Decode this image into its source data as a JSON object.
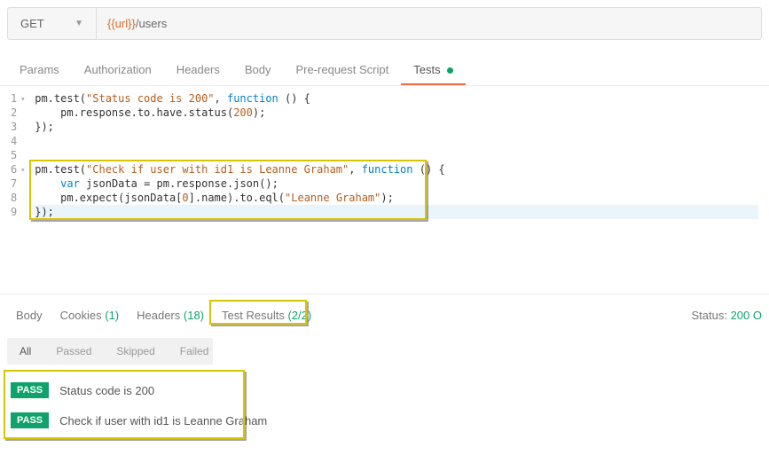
{
  "request": {
    "method": "GET",
    "url_variable": "{{url}}",
    "url_path": "/users"
  },
  "tabs": {
    "params": "Params",
    "authorization": "Authorization",
    "headers": "Headers",
    "body": "Body",
    "prerequest": "Pre-request Script",
    "tests": "Tests",
    "active": "tests"
  },
  "code": {
    "lines": {
      "l1a": "pm.test(",
      "l1b": "\"Status code is 200\"",
      "l1c": ", ",
      "l1d": "function",
      "l1e": " () {",
      "l2a": "    pm.response.to.have.status(",
      "l2b": "200",
      "l2c": ");",
      "l3": "});",
      "l4": "",
      "l5": "",
      "l6a": "pm.test(",
      "l6b": "\"Check if user with id1 is Leanne Graham\"",
      "l6c": ", ",
      "l6d": "function",
      "l6e": " () {",
      "l7a": "    ",
      "l7b": "var",
      "l7c": " jsonData = pm.response.json();",
      "l8a": "    pm.expect(jsonData[",
      "l8b": "0",
      "l8c": "].name).to.eql(",
      "l8d": "\"Leanne Graham\"",
      "l8e": ");",
      "l9": "});"
    },
    "line_numbers": [
      "1",
      "2",
      "3",
      "4",
      "5",
      "6",
      "7",
      "8",
      "9"
    ]
  },
  "response": {
    "tabs": {
      "body": "Body",
      "cookies_label": "Cookies",
      "cookies_count": "(1)",
      "headers_label": "Headers",
      "headers_count": "(18)",
      "test_results_label": "Test Results",
      "test_results_count": "(2/2)"
    },
    "status_label": "Status:",
    "status_value": "200 O"
  },
  "filters": {
    "all": "All",
    "passed": "Passed",
    "skipped": "Skipped",
    "failed": "Failed"
  },
  "results": [
    {
      "badge": "PASS",
      "name": "Status code is 200"
    },
    {
      "badge": "PASS",
      "name": "Check if user with id1 is Leanne Graham"
    }
  ]
}
